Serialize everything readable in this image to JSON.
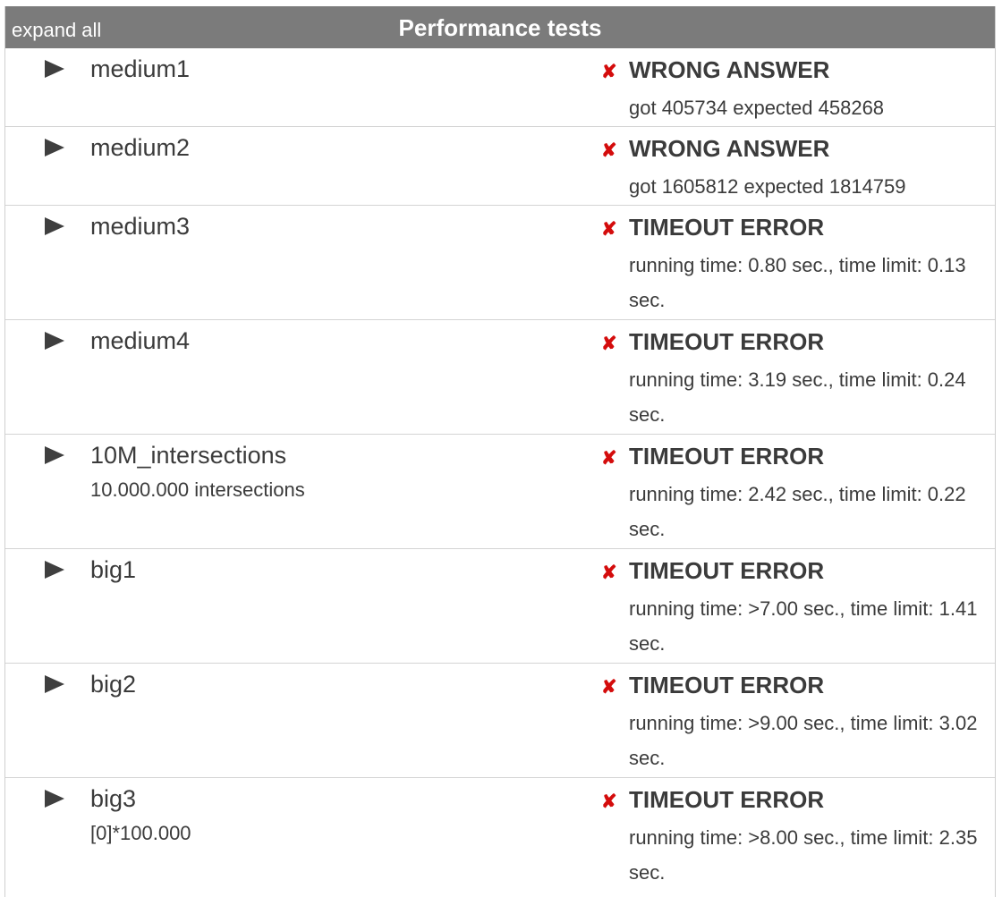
{
  "header": {
    "expand_all": "expand all",
    "title": "Performance tests"
  },
  "fail_icon": "✘",
  "colors": {
    "header_bg": "#7b7b7b",
    "fail_red": "#d40c0c",
    "text": "#3b3b3b"
  },
  "tests": [
    {
      "name": "medium1",
      "description": "",
      "status": "WRONG ANSWER",
      "detail": "got 405734 expected 458268"
    },
    {
      "name": "medium2",
      "description": "",
      "status": "WRONG ANSWER",
      "detail": "got 1605812 expected 1814759"
    },
    {
      "name": "medium3",
      "description": "",
      "status": "TIMEOUT ERROR",
      "detail": "running time: 0.80 sec., time limit: 0.13 sec."
    },
    {
      "name": "medium4",
      "description": "",
      "status": "TIMEOUT ERROR",
      "detail": "running time: 3.19 sec., time limit: 0.24 sec."
    },
    {
      "name": "10M_intersections",
      "description": "10.000.000 intersections",
      "status": "TIMEOUT ERROR",
      "detail": "running time: 2.42 sec., time limit: 0.22 sec."
    },
    {
      "name": "big1",
      "description": "",
      "status": "TIMEOUT ERROR",
      "detail": "running time: >7.00 sec., time limit: 1.41 sec."
    },
    {
      "name": "big2",
      "description": "",
      "status": "TIMEOUT ERROR",
      "detail": "running time: >9.00 sec., time limit: 3.02 sec."
    },
    {
      "name": "big3",
      "description": "[0]*100.000",
      "status": "TIMEOUT ERROR",
      "detail": "running time: >8.00 sec., time limit: 2.35 sec."
    }
  ]
}
